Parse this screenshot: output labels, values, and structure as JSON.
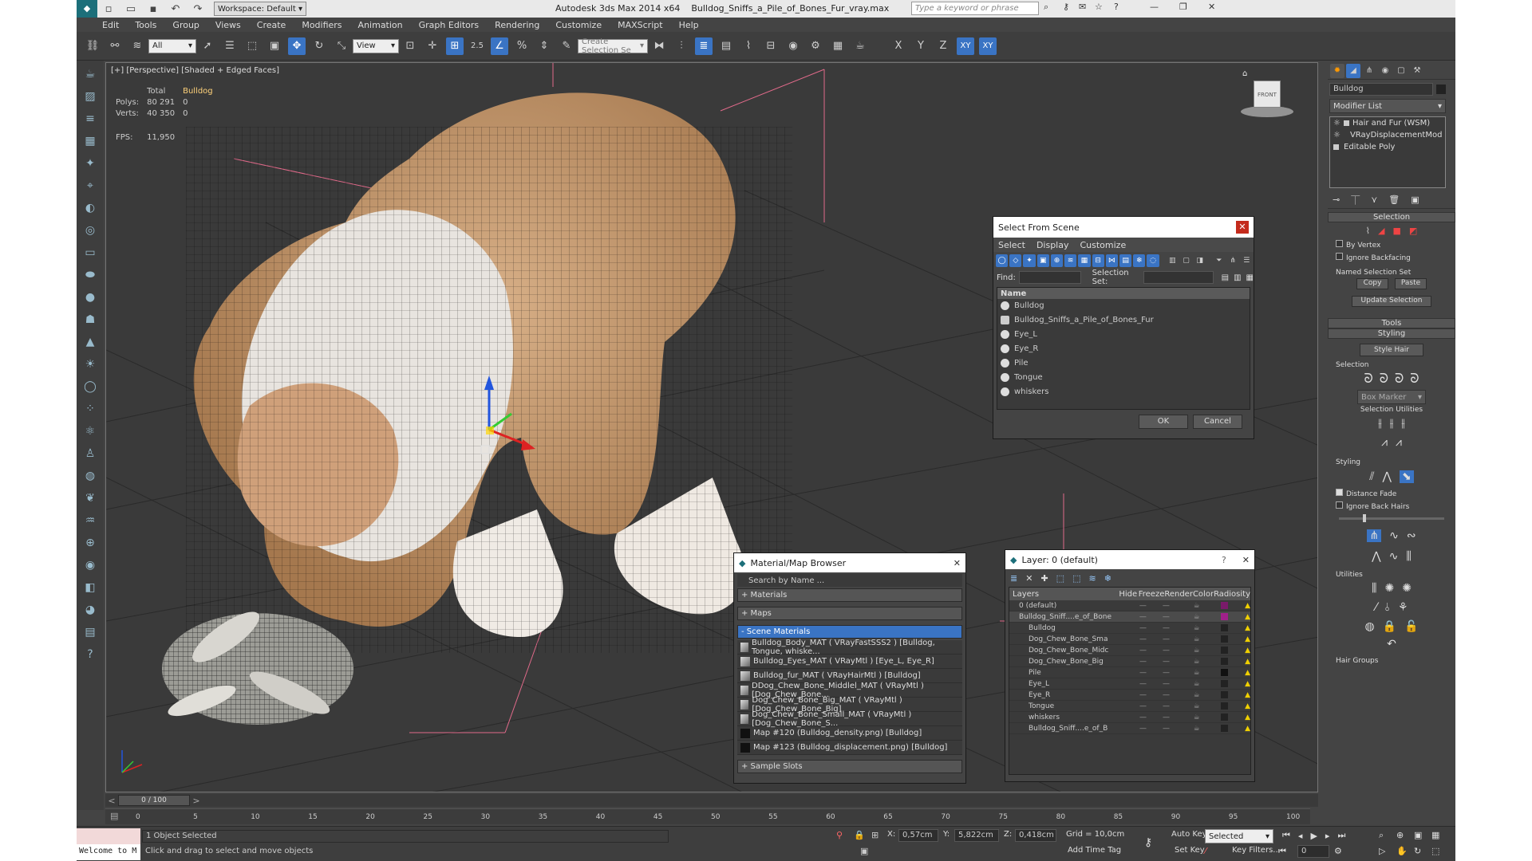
{
  "titlebar": {
    "workspace": "Workspace: Default",
    "app_name": "Autodesk 3ds Max  2014 x64",
    "file_name": "Bulldog_Sniffs_a_Pile_of_Bones_Fur_vray.max",
    "search_placeholder": "Type a keyword or phrase"
  },
  "menu": [
    "Edit",
    "Tools",
    "Group",
    "Views",
    "Create",
    "Modifiers",
    "Animation",
    "Graph Editors",
    "Rendering",
    "Customize",
    "MAXScript",
    "Help"
  ],
  "toolbar": {
    "selection_filter": "All",
    "ref_coord": "View",
    "snap_angle": "2.5",
    "selection_set_placeholder": "Create Selection Se",
    "axis_x": "X",
    "axis_y": "Y",
    "axis_z": "Z",
    "axis_xy": "XY",
    "axis_xy2": "XY"
  },
  "viewport": {
    "label": "[+] [Perspective] [Shaded + Edged Faces]",
    "stats": {
      "col_total": "Total",
      "col_obj": "Bulldog",
      "polys_label": "Polys:",
      "polys_total": "80 291",
      "polys_obj": "0",
      "verts_label": "Verts:",
      "verts_total": "40 350",
      "verts_obj": "0",
      "fps_label": "FPS:",
      "fps_value": "11,950"
    },
    "viewcube_label": "FRONT"
  },
  "select_from_scene": {
    "title": "Select From Scene",
    "menu": [
      "Select",
      "Display",
      "Customize"
    ],
    "find_label": "Find:",
    "selection_set_label": "Selection Set:",
    "name_header": "Name",
    "items": [
      "Bulldog",
      "Bulldog_Sniffs_a_Pile_of_Bones_Fur",
      "Eye_L",
      "Eye_R",
      "Pile",
      "Tongue",
      "whiskers"
    ],
    "ok": "OK",
    "cancel": "Cancel"
  },
  "material_browser": {
    "title": "Material/Map Browser",
    "search_placeholder": "Search by Name ...",
    "sections": [
      "+ Materials",
      "+ Maps",
      "- Scene Materials"
    ],
    "materials": [
      "Bulldog_Body_MAT  ( VRayFastSSS2 ) [Bulldog, Tongue, whiske...",
      "Bulldog_Eyes_MAT  ( VRayMtl ) [Eye_L, Eye_R]",
      "Bulldog_fur_MAT  ( VRayHairMtl ) [Bulldog]",
      "DDog_Chew_Bone_Middlel_MAT  ( VRayMtl ) [Dog_Chew_Bone...",
      "Dog_Chew_Bone_Big_MAT  ( VRayMtl ) [Dog_Chew_Bone_Big]",
      "Dog_Chew_Bone_Small_MAT  ( VRayMtl ) [Dog_Chew_Bone_S...",
      "Map #120 (Bulldog_density.png) [Bulldog]",
      "Map #123 (Bulldog_displacement.png) [Bulldog]"
    ],
    "sample_slots": "+ Sample Slots"
  },
  "layer_dialog": {
    "title": "Layer: 0 (default)",
    "help": "?",
    "columns": [
      "Layers",
      "Hide",
      "Freeze",
      "Render",
      "Color",
      "Radiosity"
    ],
    "rows": [
      {
        "name": "0 (default)",
        "indent": 1,
        "color": "#7a1a6a"
      },
      {
        "name": "Bulldog_Sniff....e_of_Bone",
        "indent": 1,
        "color": "#a0208a"
      },
      {
        "name": "Bulldog",
        "indent": 2,
        "color": "#222222"
      },
      {
        "name": "Dog_Chew_Bone_Sma",
        "indent": 2,
        "color": "#222222"
      },
      {
        "name": "Dog_Chew_Bone_Midc",
        "indent": 2,
        "color": "#222222"
      },
      {
        "name": "Dog_Chew_Bone_Big",
        "indent": 2,
        "color": "#222222"
      },
      {
        "name": "Pile",
        "indent": 2,
        "color": "#111111"
      },
      {
        "name": "Eye_L",
        "indent": 2,
        "color": "#222222"
      },
      {
        "name": "Eye_R",
        "indent": 2,
        "color": "#222222"
      },
      {
        "name": "Tongue",
        "indent": 2,
        "color": "#222222"
      },
      {
        "name": "whiskers",
        "indent": 2,
        "color": "#222222"
      },
      {
        "name": "Bulldog_Sniff....e_of_B",
        "indent": 2,
        "color": "#222222"
      }
    ]
  },
  "command_panel": {
    "object_name": "Bulldog",
    "modifier_list": "Modifier List",
    "stack": [
      "Hair and Fur (WSM)",
      "VRayDisplacementMod",
      "Editable Poly"
    ],
    "selection_title": "Selection",
    "by_vertex": "By Vertex",
    "ignore_backfacing": "Ignore Backfacing",
    "named_selection_set": "Named Selection Set",
    "copy": "Copy",
    "paste": "Paste",
    "update_selection": "Update Selection",
    "tools_title": "Tools",
    "styling_title": "Styling",
    "style_hair": "Style Hair",
    "sub_selection": "Selection",
    "box_marker": "Box Marker",
    "selection_utilities": "Selection Utilities",
    "sub_styling": "Styling",
    "distance_fade": "Distance Fade",
    "ignore_back_hairs": "Ignore Back Hairs",
    "utilities": "Utilities",
    "hair_groups": "Hair Groups"
  },
  "timeline": {
    "frame_display": "0 / 100",
    "ticks": [
      "0",
      "5",
      "10",
      "15",
      "20",
      "25",
      "30",
      "35",
      "40",
      "45",
      "50",
      "55",
      "60",
      "65",
      "70",
      "75",
      "80",
      "85",
      "90",
      "95",
      "100"
    ]
  },
  "status": {
    "maxscript": "Welcome to M",
    "selected": "1 Object Selected",
    "prompt": "Click and drag to select and move objects",
    "x_label": "X:",
    "x_value": "0,57cm",
    "y_label": "Y:",
    "y_value": "5,822cm",
    "z_label": "Z:",
    "z_value": "0,418cm",
    "grid": "Grid = 10,0cm",
    "add_time_tag": "Add Time Tag",
    "auto_key": "Auto Key",
    "set_key": "Set Key",
    "selected_dd": "Selected",
    "key_filters": "Key Filters...",
    "frame": "0"
  }
}
